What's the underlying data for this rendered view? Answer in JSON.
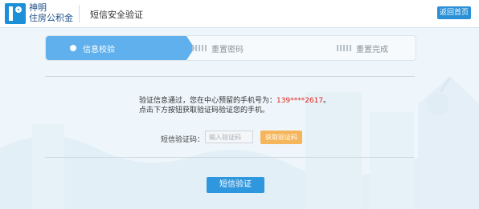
{
  "header": {
    "brand_line1": "神明",
    "brand_line2": "住房公积金",
    "title": "短信安全验证",
    "home_button": "返回首页"
  },
  "steps": [
    {
      "label": "信息校验",
      "active": true
    },
    {
      "label": "重置密码",
      "active": false
    },
    {
      "label": "重置完成",
      "active": false
    }
  ],
  "info": {
    "line1_prefix": "验证信息通过，您在中心预留的手机号为：",
    "phone": "139****2617",
    "line1_suffix": "。",
    "line2": "点击下方按钮获取验证码验证您的手机。"
  },
  "form": {
    "code_label": "短信验证码：",
    "code_placeholder": "输入验证码",
    "get_code_button": "获取验证码",
    "submit_button": "短信验证"
  },
  "colors": {
    "accent": "#2f97de",
    "step_active": "#5fb0ec",
    "warning_button": "#f5b55a",
    "phone_text": "#e2231a"
  }
}
